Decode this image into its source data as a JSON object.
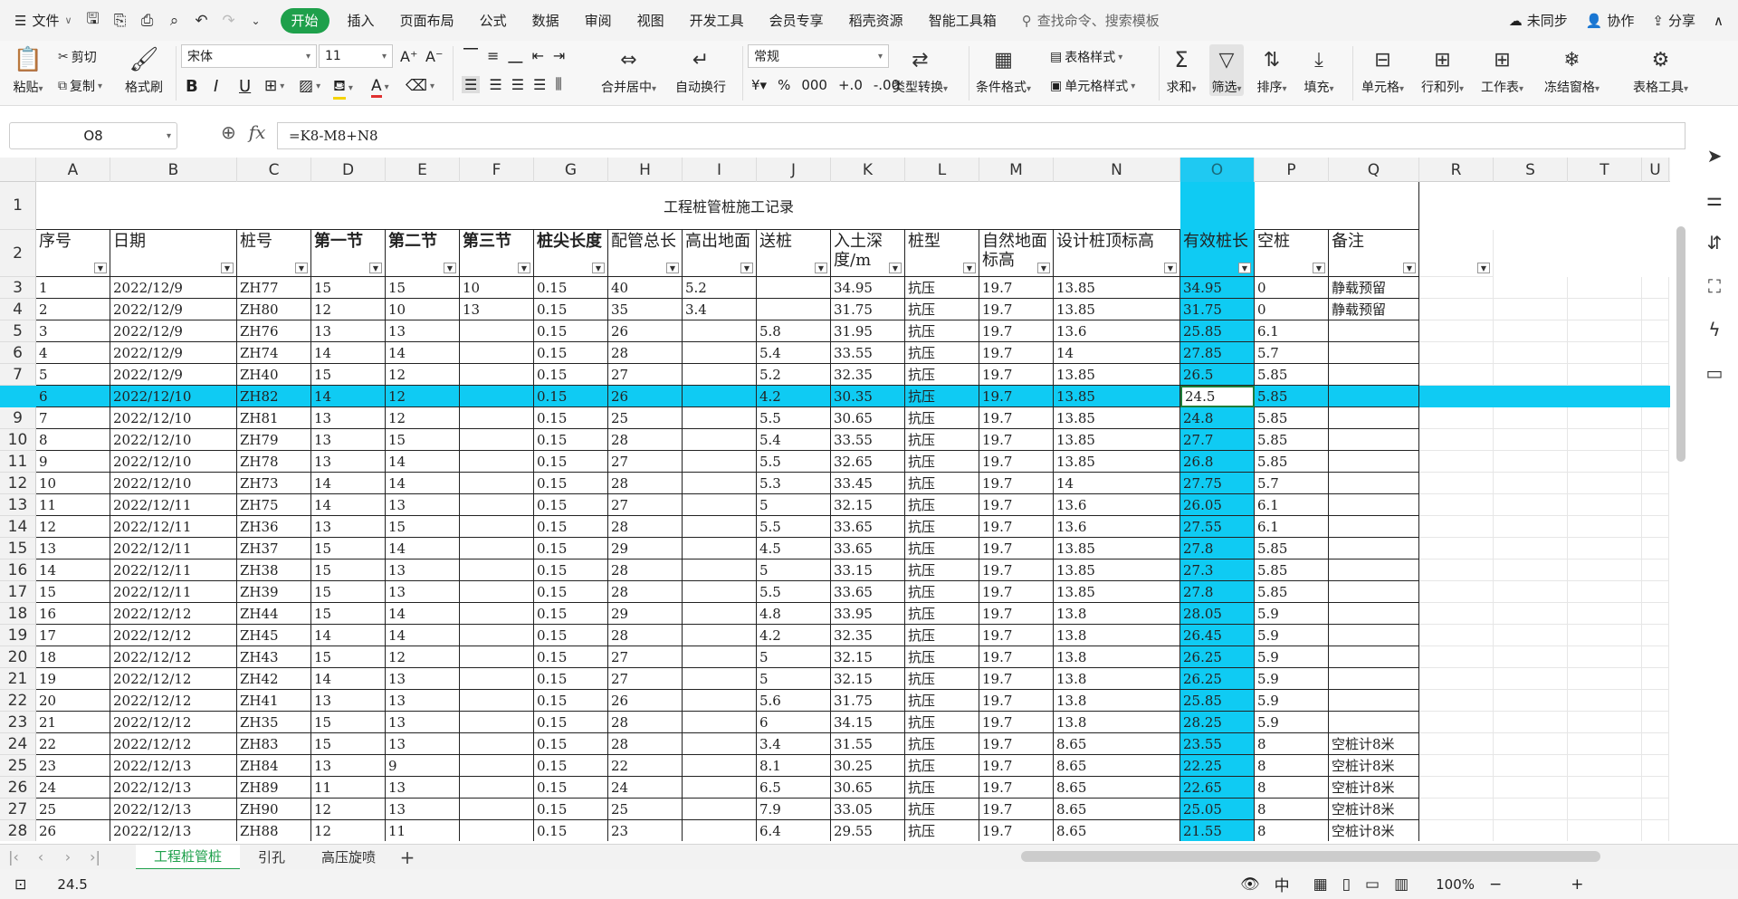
{
  "menubar": {
    "file_label": "文件",
    "tabs": [
      "开始",
      "插入",
      "页面布局",
      "公式",
      "数据",
      "审阅",
      "视图",
      "开发工具",
      "会员专享",
      "稻壳资源",
      "智能工具箱"
    ],
    "search_placeholder": "查找命令、搜索模板",
    "sync_label": "未同步",
    "collab_label": "协作",
    "share_label": "分享"
  },
  "ribbon": {
    "paste": "粘贴",
    "cut": "剪切",
    "copy": "复制",
    "format_painter": "格式刷",
    "font_name": "宋体",
    "font_size": "11",
    "merge_center": "合并居中",
    "wrap_text": "自动换行",
    "number_format": "常规",
    "type_convert": "类型转换",
    "cond_format": "条件格式",
    "table_style": "表格样式",
    "cell_style": "单元格样式",
    "sum": "求和",
    "filter": "筛选",
    "sort": "排序",
    "fill": "填充",
    "cell": "单元格",
    "row_col": "行和列",
    "sheet": "工作表",
    "freeze": "冻结窗格",
    "table_tools": "表格工具"
  },
  "formula_bar": {
    "name_box": "O8",
    "formula": "=K8-M8+N8"
  },
  "columns": [
    "A",
    "B",
    "C",
    "D",
    "E",
    "F",
    "G",
    "H",
    "I",
    "J",
    "K",
    "L",
    "M",
    "N",
    "O",
    "P",
    "Q",
    "R",
    "S",
    "T",
    "U"
  ],
  "selected_column": "O",
  "sheet_title": "工程桩管桩施工记录",
  "headers": [
    "序号",
    "日期",
    "桩号",
    "第一节",
    "第二节",
    "第三节",
    "桩尖长度",
    "配管总长",
    "高出地面",
    "送桩",
    "入土深度/m",
    "桩型",
    "自然地面标高",
    "设计桩顶标高",
    "有效桩长",
    "空桩",
    "备注"
  ],
  "rows": [
    [
      "1",
      "2022/12/9",
      "ZH77",
      "15",
      "15",
      "10",
      "0.15",
      "40",
      "5.2",
      "",
      "34.95",
      "抗压",
      "19.7",
      "13.85",
      "34.95",
      "0",
      "静载预留"
    ],
    [
      "2",
      "2022/12/9",
      "ZH80",
      "12",
      "10",
      "13",
      "0.15",
      "35",
      "3.4",
      "",
      "31.75",
      "抗压",
      "19.7",
      "13.85",
      "31.75",
      "0",
      "静载预留"
    ],
    [
      "3",
      "2022/12/9",
      "ZH76",
      "13",
      "13",
      "",
      "0.15",
      "26",
      "",
      "5.8",
      "31.95",
      "抗压",
      "19.7",
      "13.6",
      "25.85",
      "6.1",
      ""
    ],
    [
      "4",
      "2022/12/9",
      "ZH74",
      "14",
      "14",
      "",
      "0.15",
      "28",
      "",
      "5.4",
      "33.55",
      "抗压",
      "19.7",
      "14",
      "27.85",
      "5.7",
      ""
    ],
    [
      "5",
      "2022/12/9",
      "ZH40",
      "15",
      "12",
      "",
      "0.15",
      "27",
      "",
      "5.2",
      "32.35",
      "抗压",
      "19.7",
      "13.85",
      "26.5",
      "5.85",
      ""
    ],
    [
      "6",
      "2022/12/10",
      "ZH82",
      "14",
      "12",
      "",
      "0.15",
      "26",
      "",
      "4.2",
      "30.35",
      "抗压",
      "19.7",
      "13.85",
      "24.5",
      "5.85",
      ""
    ],
    [
      "7",
      "2022/12/10",
      "ZH81",
      "13",
      "12",
      "",
      "0.15",
      "25",
      "",
      "5.5",
      "30.65",
      "抗压",
      "19.7",
      "13.85",
      "24.8",
      "5.85",
      ""
    ],
    [
      "8",
      "2022/12/10",
      "ZH79",
      "13",
      "15",
      "",
      "0.15",
      "28",
      "",
      "5.4",
      "33.55",
      "抗压",
      "19.7",
      "13.85",
      "27.7",
      "5.85",
      ""
    ],
    [
      "9",
      "2022/12/10",
      "ZH78",
      "13",
      "14",
      "",
      "0.15",
      "27",
      "",
      "5.5",
      "32.65",
      "抗压",
      "19.7",
      "13.85",
      "26.8",
      "5.85",
      ""
    ],
    [
      "10",
      "2022/12/10",
      "ZH73",
      "14",
      "14",
      "",
      "0.15",
      "28",
      "",
      "5.3",
      "33.45",
      "抗压",
      "19.7",
      "14",
      "27.75",
      "5.7",
      ""
    ],
    [
      "11",
      "2022/12/11",
      "ZH75",
      "14",
      "13",
      "",
      "0.15",
      "27",
      "",
      "5",
      "32.15",
      "抗压",
      "19.7",
      "13.6",
      "26.05",
      "6.1",
      ""
    ],
    [
      "12",
      "2022/12/11",
      "ZH36",
      "13",
      "15",
      "",
      "0.15",
      "28",
      "",
      "5.5",
      "33.65",
      "抗压",
      "19.7",
      "13.6",
      "27.55",
      "6.1",
      ""
    ],
    [
      "13",
      "2022/12/11",
      "ZH37",
      "15",
      "14",
      "",
      "0.15",
      "29",
      "",
      "4.5",
      "33.65",
      "抗压",
      "19.7",
      "13.85",
      "27.8",
      "5.85",
      ""
    ],
    [
      "14",
      "2022/12/11",
      "ZH38",
      "15",
      "13",
      "",
      "0.15",
      "28",
      "",
      "5",
      "33.15",
      "抗压",
      "19.7",
      "13.85",
      "27.3",
      "5.85",
      ""
    ],
    [
      "15",
      "2022/12/11",
      "ZH39",
      "15",
      "13",
      "",
      "0.15",
      "28",
      "",
      "5.5",
      "33.65",
      "抗压",
      "19.7",
      "13.85",
      "27.8",
      "5.85",
      ""
    ],
    [
      "16",
      "2022/12/12",
      "ZH44",
      "15",
      "14",
      "",
      "0.15",
      "29",
      "",
      "4.8",
      "33.95",
      "抗压",
      "19.7",
      "13.8",
      "28.05",
      "5.9",
      ""
    ],
    [
      "17",
      "2022/12/12",
      "ZH45",
      "14",
      "14",
      "",
      "0.15",
      "28",
      "",
      "4.2",
      "32.35",
      "抗压",
      "19.7",
      "13.8",
      "26.45",
      "5.9",
      ""
    ],
    [
      "18",
      "2022/12/12",
      "ZH43",
      "15",
      "12",
      "",
      "0.15",
      "27",
      "",
      "5",
      "32.15",
      "抗压",
      "19.7",
      "13.8",
      "26.25",
      "5.9",
      ""
    ],
    [
      "19",
      "2022/12/12",
      "ZH42",
      "14",
      "13",
      "",
      "0.15",
      "27",
      "",
      "5",
      "32.15",
      "抗压",
      "19.7",
      "13.8",
      "26.25",
      "5.9",
      ""
    ],
    [
      "20",
      "2022/12/12",
      "ZH41",
      "13",
      "13",
      "",
      "0.15",
      "26",
      "",
      "5.6",
      "31.75",
      "抗压",
      "19.7",
      "13.8",
      "25.85",
      "5.9",
      ""
    ],
    [
      "21",
      "2022/12/12",
      "ZH35",
      "15",
      "13",
      "",
      "0.15",
      "28",
      "",
      "6",
      "34.15",
      "抗压",
      "19.7",
      "13.8",
      "28.25",
      "5.9",
      ""
    ],
    [
      "22",
      "2022/12/12",
      "ZH83",
      "15",
      "13",
      "",
      "0.15",
      "28",
      "",
      "3.4",
      "31.55",
      "抗压",
      "19.7",
      "8.65",
      "23.55",
      "8",
      "空桩计8米"
    ],
    [
      "23",
      "2022/12/13",
      "ZH84",
      "13",
      "9",
      "",
      "0.15",
      "22",
      "",
      "8.1",
      "30.25",
      "抗压",
      "19.7",
      "8.65",
      "22.25",
      "8",
      "空桩计8米"
    ],
    [
      "24",
      "2022/12/13",
      "ZH89",
      "11",
      "13",
      "",
      "0.15",
      "24",
      "",
      "6.5",
      "30.65",
      "抗压",
      "19.7",
      "8.65",
      "22.65",
      "8",
      "空桩计8米"
    ],
    [
      "25",
      "2022/12/13",
      "ZH90",
      "12",
      "13",
      "",
      "0.15",
      "25",
      "",
      "7.9",
      "33.05",
      "抗压",
      "19.7",
      "8.65",
      "25.05",
      "8",
      "空桩计8米"
    ],
    [
      "26",
      "2022/12/13",
      "ZH88",
      "12",
      "11",
      "",
      "0.15",
      "23",
      "",
      "6.4",
      "29.55",
      "抗压",
      "19.7",
      "8.65",
      "21.55",
      "8",
      "空桩计8米"
    ]
  ],
  "selected_row_index": 5,
  "sheet_tabs": [
    "工程桩管桩",
    "引孔",
    "高压旋喷"
  ],
  "active_sheet": "工程桩管桩",
  "status": {
    "cell_value": "24.5",
    "zoom": "100%"
  },
  "colors": {
    "accent_green": "#1ea04b",
    "selection_cyan": "#0fcbf3"
  }
}
